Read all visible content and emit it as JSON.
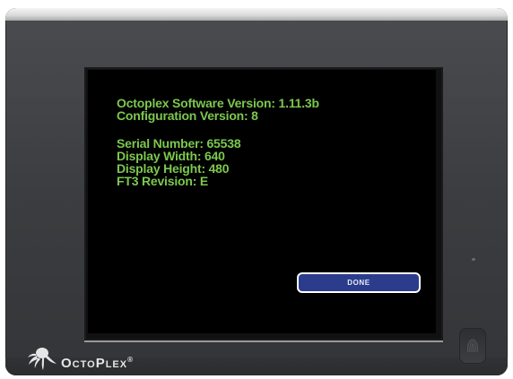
{
  "screen": {
    "software_version": "Octoplex Software Version: 1.11.3b",
    "configuration_version": "Configuration Version: 8",
    "serial_number": "Serial Number: 65538",
    "display_width": "Display Width: 640",
    "display_height": "Display Height: 480",
    "ft3_revision": "FT3 Revision: E",
    "done_label": "DONE"
  },
  "device": {
    "brand": "OctoPlex",
    "trademark": "®"
  },
  "colors": {
    "text_green": "#7cc84e",
    "button_blue": "#2b3c8c",
    "screen_bg": "#000000",
    "bezel": "#3b3d40"
  },
  "icons": {
    "logo": "octopus-logo-icon",
    "sensor": "fingerprint-icon",
    "led": "indicator-led"
  }
}
